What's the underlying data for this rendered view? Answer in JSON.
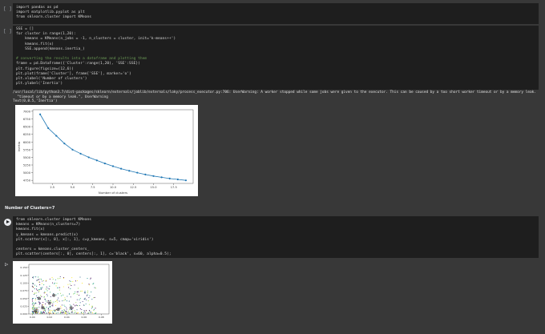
{
  "cell1": {
    "bracket": "[ ]",
    "code": [
      "import pandas as pd",
      "import matplotlib.pyplot as plt",
      "from sklearn.cluster import KMeans"
    ]
  },
  "cell2": {
    "bracket": "[ ]",
    "code": [
      "SSE = []",
      "for cluster in range(1,20):",
      "    kmeans = KMeans(n_jobs = -1, n_clusters = cluster, init='k-means++')",
      "    kmeans.fit(x)",
      "    SSE.append(kmeans.inertia_)",
      "",
      "# converting the results into a dataframe and plotting them",
      "frame = pd.DataFrame({'Cluster':range(1,20), 'SSE':SSE})",
      "plt.figure(figsize=(12,6))",
      "plt.plot(frame['Cluster'], frame['SSE'], marker='o')",
      "plt.xlabel('Number of clusters')",
      "plt.ylabel('Inertia')"
    ],
    "output_text": [
      "/usr/local/lib/python3.7/dist-packages/sklearn/externals/joblib/externals/loky/process_executor.py:706: UserWarning: A worker stopped while some jobs were given to the executor. This can be caused by a too short worker timeout or by a memory leak.",
      "  \"timeout or by a memory leak.\", UserWarning",
      "Text(0,0.5,'Inertia')"
    ]
  },
  "markdown": {
    "heading": "Number of Clusters=7"
  },
  "cell3": {
    "code": [
      "from sklearn.cluster import KMeans",
      "kmeans = KMeans(n_clusters=7)",
      "kmeans.fit(x)",
      "y_kmeans = kmeans.predict(x)",
      "plt.scatter(x[:, 0], x[:, 1], c=y_kmeans, s=5, cmap='viridis')",
      "",
      "centers = kmeans.cluster_centers_",
      "plt.scatter(centers[:, 0], centers[:, 1], c='black', s=60, alpha=0.5);"
    ]
  },
  "chart_data": [
    {
      "type": "line",
      "xlabel": "Number of clusters",
      "ylabel": "Inertia",
      "x": [
        1,
        2,
        3,
        4,
        5,
        6,
        7,
        8,
        9,
        10,
        11,
        12,
        13,
        14,
        15,
        16,
        17,
        18,
        19
      ],
      "y": [
        6900,
        6450,
        6200,
        5950,
        5750,
        5620,
        5500,
        5400,
        5300,
        5210,
        5130,
        5060,
        5000,
        4940,
        4890,
        4850,
        4810,
        4780,
        4750
      ],
      "xticks": [
        "2.5",
        "5.0",
        "7.5",
        "10.0",
        "12.5",
        "15.0",
        "17.5"
      ],
      "yticks": [
        "4750",
        "5000",
        "5250",
        "5500",
        "5750",
        "6000",
        "6250",
        "6500",
        "6750",
        "7000"
      ],
      "xlim": [
        0.1,
        19.9
      ],
      "ylim": [
        4650,
        7050
      ],
      "color": "#1f77b4"
    },
    {
      "type": "scatter",
      "xticks": [
        "0.00",
        "0.02",
        "0.04",
        "0.06",
        "0.08"
      ],
      "yticks": [
        "0.000",
        "0.025",
        "0.050",
        "0.075",
        "0.100",
        "0.125",
        "0.150"
      ],
      "xlim": [
        -0.004,
        0.089
      ],
      "ylim": [
        0.0,
        0.16
      ],
      "cmap": "viridis"
    }
  ]
}
